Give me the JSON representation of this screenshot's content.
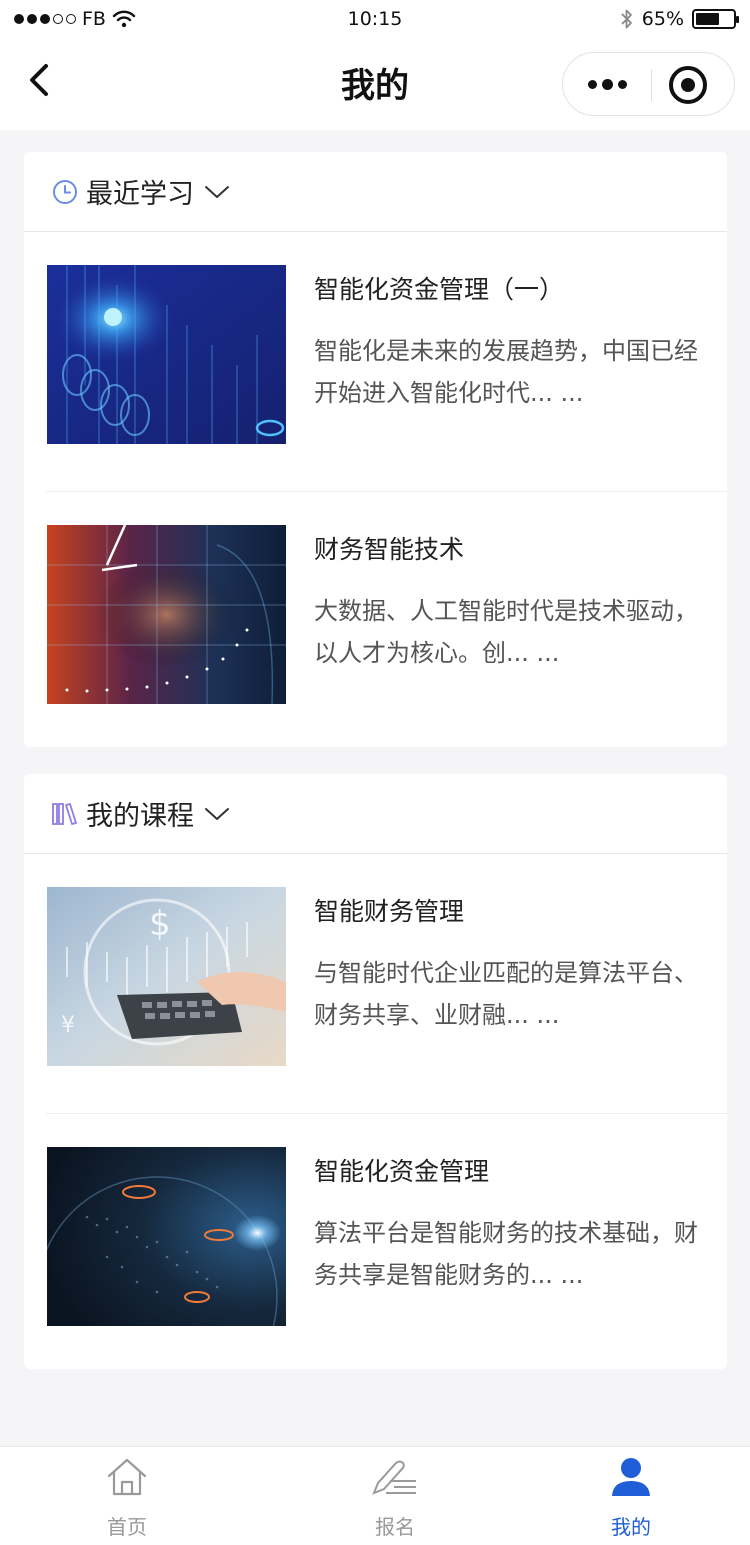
{
  "status_bar": {
    "carrier": "FB",
    "time": "10:15",
    "battery": "65%",
    "battery_level": 0.65,
    "signal_bars": 3
  },
  "nav": {
    "title": "我的",
    "capsule_icons": [
      "more-icon",
      "target-icon"
    ]
  },
  "recent": {
    "title": "最近学习",
    "icon": "clock-icon",
    "items": [
      {
        "title": "智能化资金管理（一）",
        "desc": "智能化是未来的发展趋势，中国已经开始进入智能化时代... ..."
      },
      {
        "title": "财务智能技术",
        "desc": "大数据、人工智能时代是技术驱动，以人才为核心。创... ..."
      }
    ]
  },
  "courses": {
    "title": "我的课程",
    "icon": "books-icon",
    "items": [
      {
        "title": "智能财务管理",
        "desc": "与智能时代企业匹配的是算法平台、财务共享、业财融... ..."
      },
      {
        "title": "智能化资金管理",
        "desc": "算法平台是智能财务的技术基础，财务共享是智能财务的... ..."
      }
    ]
  },
  "tabbar": {
    "tabs": [
      {
        "label": "首页",
        "icon": "home-icon",
        "active": false
      },
      {
        "label": "报名",
        "icon": "signup-icon",
        "active": false
      },
      {
        "label": "我的",
        "icon": "user-icon",
        "active": true
      }
    ]
  },
  "colors": {
    "accent": "#1f5ed6",
    "background": "#f5f5f7",
    "icon_purple": "#8f7ee6",
    "icon_blue": "#6b8be8"
  }
}
